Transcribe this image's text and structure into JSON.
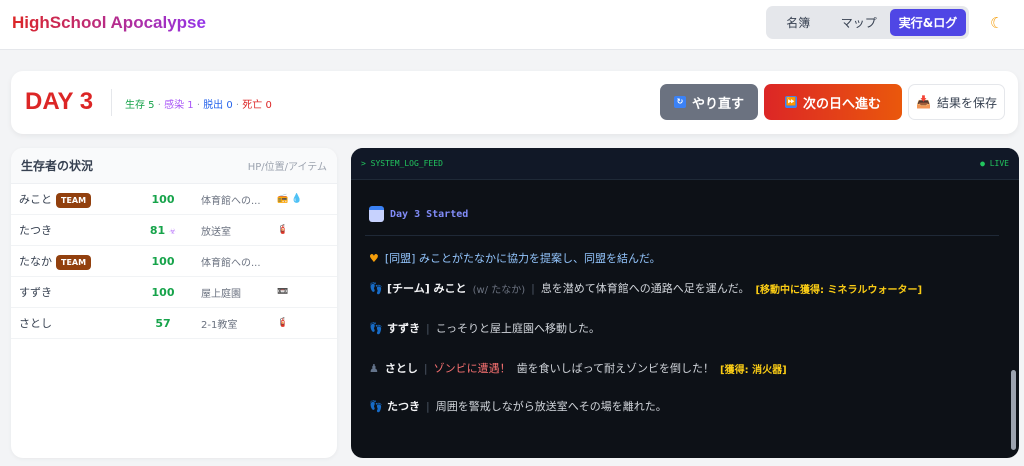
{
  "header": {
    "title": "HighSchool Apocalypse",
    "tabs": [
      "名簿",
      "マップ",
      "実行&ログ"
    ],
    "active_tab": 2,
    "theme_icon": "moon-icon"
  },
  "day": {
    "label": "DAY 3",
    "stats": [
      {
        "text": "生存 5",
        "color": "#16a34a"
      },
      {
        "text": "感染 1",
        "color": "#a855f7"
      },
      {
        "text": "脱出 0",
        "color": "#2563eb"
      },
      {
        "text": "死亡 0",
        "color": "#dc2626"
      }
    ],
    "buttons": {
      "redo": "やり直す",
      "next": "次の日へ進む",
      "save": "結果を保存"
    }
  },
  "survivors": {
    "title": "生存者の状況",
    "subtitle": "HP/位置/アイテム",
    "team_badge": "TEAM",
    "rows": [
      {
        "name": "みこと",
        "team": true,
        "hp": "100",
        "infected": false,
        "location": "体育館への...",
        "items": "📻 💧"
      },
      {
        "name": "たつき",
        "team": false,
        "hp": "81",
        "infected": true,
        "location": "放送室",
        "items": "🧯"
      },
      {
        "name": "たなか",
        "team": true,
        "hp": "100",
        "infected": false,
        "location": "体育館への...",
        "items": ""
      },
      {
        "name": "すずき",
        "team": false,
        "hp": "100",
        "infected": false,
        "location": "屋上庭園",
        "items": "📼"
      },
      {
        "name": "さとし",
        "team": false,
        "hp": "57",
        "infected": false,
        "location": "2-1教室",
        "items": "🧯"
      }
    ]
  },
  "log": {
    "title": "> SYSTEM_LOG_FEED",
    "live": "● LIVE",
    "day_started": "Day 3 Started",
    "alliance": "[同盟] みことがたなかに協力を提案し、同盟を結んだ。",
    "entries": [
      {
        "who": "[チーム] みこと",
        "with": "(w/ たなか)",
        "event": "",
        "text": "息を潜めて体育館への通路へ足を運んだ。",
        "gain": "[移動中に獲得: ミネラルウォーター]"
      },
      {
        "who": "すずき",
        "with": "",
        "event": "",
        "text": "こっそりと屋上庭園へ移動した。",
        "gain": ""
      },
      {
        "who": "さとし",
        "with": "",
        "event": "ゾンビに遭遇！",
        "text": "歯を食いしばって耐えゾンビを倒した！",
        "gain": "[獲得: 消火器]"
      },
      {
        "who": "たつき",
        "with": "",
        "event": "",
        "text": "周囲を警戒しながら放送室へその場を離れた。",
        "gain": ""
      }
    ]
  }
}
